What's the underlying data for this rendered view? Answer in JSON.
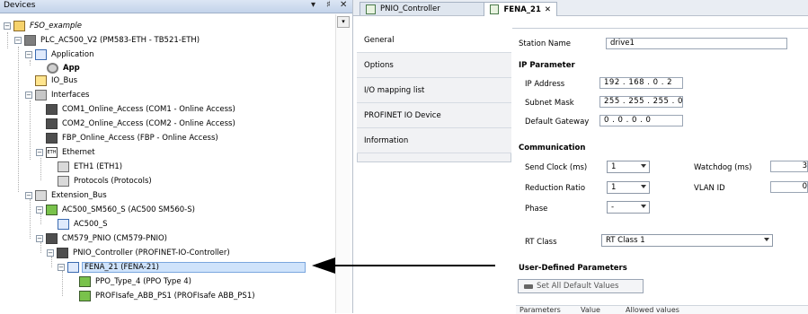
{
  "devices_panel": {
    "title": "Devices",
    "controls": [
      "▾",
      "♯",
      "✕"
    ],
    "tree": [
      {
        "label": "FSO_example",
        "italic": true
      },
      {
        "label": "PLC_AC500_V2 (PM583-ETH - TB521-ETH)"
      },
      {
        "label": "Application"
      },
      {
        "label": "App",
        "bold": true
      },
      {
        "label": "IO_Bus"
      },
      {
        "label": "Interfaces"
      },
      {
        "label": "COM1_Online_Access (COM1 - Online Access)"
      },
      {
        "label": "COM2_Online_Access (COM2 - Online Access)"
      },
      {
        "label": "FBP_Online_Access (FBP - Online Access)"
      },
      {
        "label": "Ethernet"
      },
      {
        "label": "ETH1 (ETH1)"
      },
      {
        "label": "Protocols (Protocols)"
      },
      {
        "label": "Extension_Bus"
      },
      {
        "label": "AC500_SM560_S (AC500 SM560-S)"
      },
      {
        "label": "AC500_S"
      },
      {
        "label": "CM579_PNIO (CM579-PNIO)"
      },
      {
        "label": "PNIO_Controller (PROFINET-IO-Controller)"
      },
      {
        "label": "FENA_21 (FENA-21)",
        "selected": true
      },
      {
        "label": "PPO_Type_4 (PPO Type 4)"
      },
      {
        "label": "PROFIsafe_ABB_PS1 (PROFIsafe ABB_PS1)"
      }
    ]
  },
  "editor": {
    "tabs": [
      {
        "label": "PNIO_Controller"
      },
      {
        "label": "FENA_21",
        "close": "✕",
        "active": true
      }
    ],
    "nav": [
      {
        "label": "General",
        "active": true
      },
      {
        "label": "Options"
      },
      {
        "label": "I/O mapping list"
      },
      {
        "label": "PROFINET IO Device"
      },
      {
        "label": "Information"
      }
    ],
    "station_name_label": "Station Name",
    "station_name_value": "drive1",
    "ip_header": "IP Parameter",
    "ip_address_label": "IP Address",
    "ip_address_value": "192 . 168 . 0 . 2",
    "subnet_label": "Subnet Mask",
    "subnet_value": "255 . 255 . 255 . 0",
    "gateway_label": "Default Gateway",
    "gateway_value": "0 . 0 . 0 . 0",
    "comm_header": "Communication",
    "send_clock_label": "Send Clock (ms)",
    "send_clock_value": "1",
    "watchdog_label": "Watchdog (ms)",
    "watchdog_value": "3",
    "reduction_label": "Reduction Ratio",
    "reduction_value": "1",
    "vlan_label": "VLAN ID",
    "vlan_value": "0",
    "phase_label": "Phase",
    "phase_value": "-",
    "rt_class_label": "RT Class",
    "rt_class_value": "RT Class 1",
    "udp_header": "User-Defined Parameters",
    "set_defaults_label": "Set All Default Values",
    "grid_headers": [
      "Parameters",
      "Value",
      "Allowed values"
    ]
  }
}
